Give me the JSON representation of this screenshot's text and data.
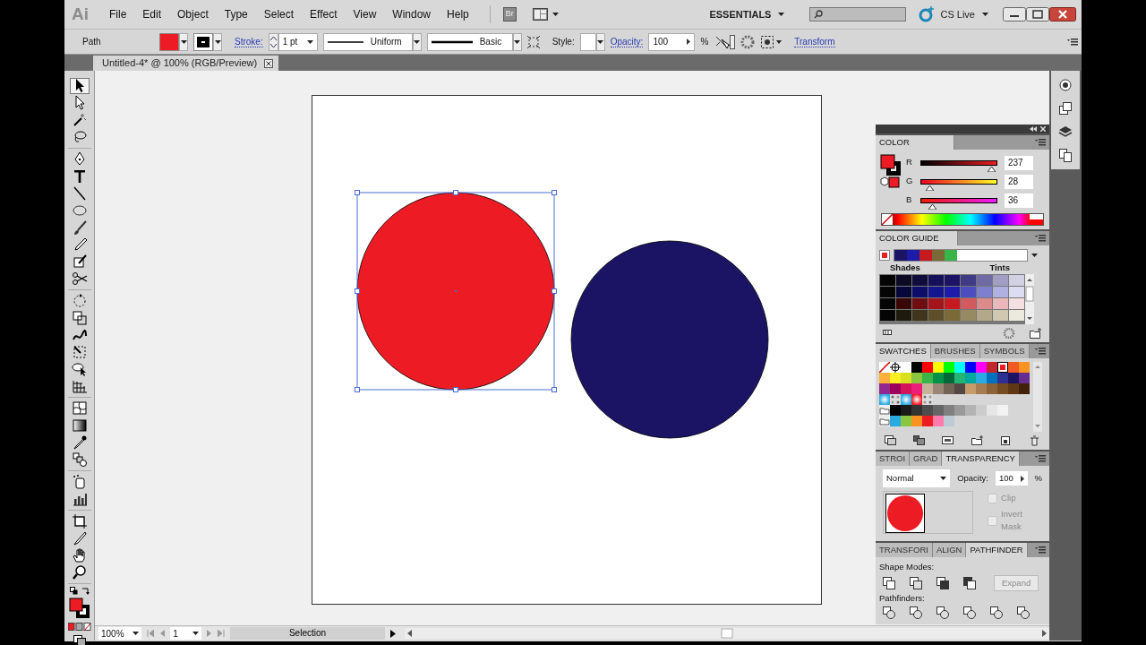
{
  "app_logo": "Ai",
  "menu": [
    "File",
    "Edit",
    "Object",
    "Type",
    "Select",
    "Effect",
    "View",
    "Window",
    "Help"
  ],
  "bridge_button": "Br",
  "workspace": "ESSENTIALS",
  "cs_live": "CS Live",
  "control_bar": {
    "selection_type": "Path",
    "fill": {
      "color": "#ed1c24"
    },
    "stroke_label": "Stroke:",
    "stroke_field": "1 pt",
    "profile": "Uniform",
    "brush": "Basic",
    "style_label": "Style:",
    "opacity_label": "Opacity:",
    "opacity": "100",
    "percent": "%",
    "transform": "Transform"
  },
  "document_tab": {
    "title": "Untitled-4* @ 100% (RGB/Preview)"
  },
  "tools": [
    {
      "kind": "selection",
      "selected": true
    },
    {
      "kind": "direct-selection",
      "selected": false
    },
    {
      "kind": "magic-wand",
      "selected": false
    },
    {
      "kind": "lasso",
      "selected": false
    },
    {
      "kind": "pen",
      "selected": false
    },
    {
      "kind": "type",
      "selected": false
    },
    {
      "kind": "line",
      "selected": false
    },
    {
      "kind": "ellipse",
      "selected": false
    },
    {
      "kind": "paintbrush",
      "selected": false
    },
    {
      "kind": "pencil",
      "selected": false
    },
    {
      "kind": "blob-brush",
      "selected": false
    },
    {
      "kind": "scissors",
      "selected": false
    },
    {
      "kind": "rotate",
      "selected": false
    },
    {
      "kind": "scale",
      "selected": false
    },
    {
      "kind": "warp",
      "selected": false
    },
    {
      "kind": "free-transform",
      "selected": false
    },
    {
      "kind": "shape-builder",
      "selected": false
    },
    {
      "kind": "grid",
      "selected": false
    },
    {
      "kind": "mesh",
      "selected": false
    },
    {
      "kind": "gradient",
      "selected": false
    },
    {
      "kind": "eyedropper",
      "selected": false
    },
    {
      "kind": "blend",
      "selected": false
    },
    {
      "kind": "sprayer",
      "selected": false
    },
    {
      "kind": "graph",
      "selected": false
    },
    {
      "kind": "artboard",
      "selected": false
    },
    {
      "kind": "slice",
      "selected": false
    },
    {
      "kind": "hand",
      "selected": false
    },
    {
      "kind": "zoom",
      "selected": false
    }
  ],
  "tool_fill": {
    "color": "#ed1c24"
  },
  "artboard": {
    "shapes": [
      {
        "kind": "circle",
        "color": "#ed1c24",
        "selected": true
      },
      {
        "kind": "circle",
        "color": "#1b1464",
        "selected": false
      }
    ]
  },
  "color_panel": {
    "tabs": [
      {
        "label": "COLOR",
        "selected": true
      }
    ],
    "fill": {
      "color": "#ed1c24"
    },
    "channels": [
      {
        "label": "R",
        "value": "237",
        "level": 0.93
      },
      {
        "label": "G",
        "value": "28",
        "level": 0.11
      },
      {
        "label": "B",
        "value": "36",
        "level": 0.14
      }
    ]
  },
  "color_guide": {
    "tabs": [
      {
        "label": "COLOR GUIDE",
        "selected": true
      }
    ],
    "harmony": [
      {
        "color": "#1b1464"
      },
      {
        "color": "#1c1ca8"
      },
      {
        "color": "#c41a20"
      },
      {
        "color": "#7a6a38"
      },
      {
        "color": "#39b54a"
      }
    ],
    "shades_label": "Shades",
    "tints_label": "Tints",
    "grid": [
      [
        {
          "color": "#050505"
        },
        {
          "color": "#0d0b23"
        },
        {
          "color": "#100d3c"
        },
        {
          "color": "#14105a"
        },
        {
          "color": "#1b1464"
        },
        {
          "color": "#3f3a84"
        },
        {
          "color": "#6f6aa3"
        },
        {
          "color": "#a19dc3"
        },
        {
          "color": "#d2d0e3"
        }
      ],
      [
        {
          "color": "#050505"
        },
        {
          "color": "#07073a"
        },
        {
          "color": "#0e0e6a"
        },
        {
          "color": "#15158f"
        },
        {
          "color": "#1c1ca8"
        },
        {
          "color": "#4d4dc0"
        },
        {
          "color": "#7f7fd0"
        },
        {
          "color": "#b0b0e2"
        },
        {
          "color": "#dcdcf3"
        }
      ],
      [
        {
          "color": "#050505"
        },
        {
          "color": "#3a0709"
        },
        {
          "color": "#6e0e12"
        },
        {
          "color": "#a4151b"
        },
        {
          "color": "#c41a20"
        },
        {
          "color": "#d05a5e"
        },
        {
          "color": "#dd8a8d"
        },
        {
          "color": "#eab8ba"
        },
        {
          "color": "#f5e0e1"
        }
      ],
      [
        {
          "color": "#050505"
        },
        {
          "color": "#1e1a0e"
        },
        {
          "color": "#3e351c"
        },
        {
          "color": "#5d4f2a"
        },
        {
          "color": "#7a6a38"
        },
        {
          "color": "#968a62"
        },
        {
          "color": "#b3a98a"
        },
        {
          "color": "#d0c9b2"
        },
        {
          "color": "#ece9df"
        }
      ]
    ]
  },
  "swatch_tabs": [
    {
      "label": "SWATCHES",
      "selected": true
    },
    {
      "label": "BRUSHES",
      "selected": false
    },
    {
      "label": "SYMBOLS",
      "selected": false
    }
  ],
  "swatch_rows": [
    [
      {
        "kind": "none",
        "selected": false
      },
      {
        "kind": "registration",
        "selected": false
      },
      {
        "kind": "color",
        "color": "#ffffff",
        "selected": false
      },
      {
        "kind": "color",
        "color": "#000000",
        "selected": false
      },
      {
        "kind": "color",
        "color": "#ff0000",
        "selected": false
      },
      {
        "kind": "color",
        "color": "#ffff00",
        "selected": false
      },
      {
        "kind": "color",
        "color": "#00ff00",
        "selected": false
      },
      {
        "kind": "color",
        "color": "#00ffff",
        "selected": false
      },
      {
        "kind": "color",
        "color": "#0000ff",
        "selected": false
      },
      {
        "kind": "color",
        "color": "#ff00ff",
        "selected": false
      },
      {
        "kind": "color",
        "color": "#c1272d",
        "selected": false
      },
      {
        "kind": "color",
        "color": "#ed1c24",
        "selected": true
      },
      {
        "kind": "color",
        "color": "#f15a24",
        "selected": false
      },
      {
        "kind": "color",
        "color": "#f7931e",
        "selected": false
      }
    ],
    [
      {
        "kind": "color",
        "color": "#fbb03b",
        "selected": false
      },
      {
        "kind": "color",
        "color": "#fcee21",
        "selected": false
      },
      {
        "kind": "color",
        "color": "#d9e021",
        "selected": false
      },
      {
        "kind": "color",
        "color": "#8cc63f",
        "selected": false
      },
      {
        "kind": "color",
        "color": "#39b54a",
        "selected": false
      },
      {
        "kind": "color",
        "color": "#009245",
        "selected": false
      },
      {
        "kind": "color",
        "color": "#006837",
        "selected": false
      },
      {
        "kind": "color",
        "color": "#22b573",
        "selected": false
      },
      {
        "kind": "color",
        "color": "#00a99d",
        "selected": false
      },
      {
        "kind": "color",
        "color": "#29abe2",
        "selected": false
      },
      {
        "kind": "color",
        "color": "#0071bc",
        "selected": false
      },
      {
        "kind": "color",
        "color": "#2e3192",
        "selected": false
      },
      {
        "kind": "color",
        "color": "#1b1464",
        "selected": false
      },
      {
        "kind": "color",
        "color": "#662d91",
        "selected": false
      }
    ],
    [
      {
        "kind": "color",
        "color": "#93278f",
        "selected": false
      },
      {
        "kind": "color",
        "color": "#9e005d",
        "selected": false
      },
      {
        "kind": "color",
        "color": "#d4145a",
        "selected": false
      },
      {
        "kind": "color",
        "color": "#ed1e79",
        "selected": false
      },
      {
        "kind": "color",
        "color": "#c7b299",
        "selected": false
      },
      {
        "kind": "color",
        "color": "#998675",
        "selected": false
      },
      {
        "kind": "color",
        "color": "#736357",
        "selected": false
      },
      {
        "kind": "color",
        "color": "#534741",
        "selected": false
      },
      {
        "kind": "color",
        "color": "#c69c6d",
        "selected": false
      },
      {
        "kind": "color",
        "color": "#a67c52",
        "selected": false
      },
      {
        "kind": "color",
        "color": "#8c6239",
        "selected": false
      },
      {
        "kind": "color",
        "color": "#754c24",
        "selected": false
      },
      {
        "kind": "color",
        "color": "#603813",
        "selected": false
      },
      {
        "kind": "color",
        "color": "#42210b",
        "selected": false
      }
    ],
    [
      {
        "kind": "gradient",
        "selected": false
      },
      {
        "kind": "pattern",
        "selected": false
      },
      {
        "kind": "gradient",
        "selected": false
      },
      {
        "kind": "gradient",
        "selected": false
      },
      {
        "kind": "pattern",
        "selected": false
      }
    ],
    [
      {
        "kind": "folder",
        "selected": false
      },
      {
        "kind": "color",
        "color": "#000000",
        "selected": false
      },
      {
        "kind": "color",
        "color": "#1a1a1a",
        "selected": false
      },
      {
        "kind": "color",
        "color": "#333333",
        "selected": false
      },
      {
        "kind": "color",
        "color": "#4d4d4d",
        "selected": false
      },
      {
        "kind": "color",
        "color": "#666666",
        "selected": false
      },
      {
        "kind": "color",
        "color": "#808080",
        "selected": false
      },
      {
        "kind": "color",
        "color": "#999999",
        "selected": false
      },
      {
        "kind": "color",
        "color": "#b3b3b3",
        "selected": false
      },
      {
        "kind": "color",
        "color": "#cccccc",
        "selected": false
      },
      {
        "kind": "color",
        "color": "#e6e6e6",
        "selected": false
      },
      {
        "kind": "color",
        "color": "#f2f2f2",
        "selected": false
      }
    ],
    [
      {
        "kind": "folder",
        "selected": false
      },
      {
        "kind": "color",
        "color": "#29abe2",
        "selected": false
      },
      {
        "kind": "color",
        "color": "#8cc63f",
        "selected": false
      },
      {
        "kind": "color",
        "color": "#f7931e",
        "selected": false
      },
      {
        "kind": "color",
        "color": "#ed1c24",
        "selected": false
      },
      {
        "kind": "color",
        "color": "#ff7bac",
        "selected": false
      },
      {
        "kind": "color",
        "color": "#bdccd4",
        "selected": false
      }
    ]
  ],
  "transparency_tabs": [
    {
      "label": "STROI",
      "selected": false
    },
    {
      "label": "GRAD",
      "selected": false
    },
    {
      "label": "TRANSPARENCY",
      "selected": true
    }
  ],
  "transparency": {
    "mode": "Normal",
    "opacity_label": "Opacity:",
    "opacity": "100",
    "percent": "%",
    "thumbnail": {
      "color": "#ed1c24"
    },
    "options": [
      {
        "label": "Clip",
        "checked": false,
        "disabled": true
      },
      {
        "label": "Invert Mask",
        "checked": false,
        "disabled": true
      }
    ]
  },
  "pathfinder_tabs": [
    {
      "label": "TRANSFORI",
      "selected": false
    },
    {
      "label": "ALIGN",
      "selected": false
    },
    {
      "label": "PATHFINDER",
      "selected": true
    }
  ],
  "pathfinder": {
    "shape_modes_label": "Shape Modes:",
    "expand": {
      "label": "Expand",
      "disabled": true
    },
    "pathfinders_label": "Pathfinders:"
  },
  "status_bar": {
    "zoom": "100%",
    "page": "1",
    "tool": "Selection"
  }
}
